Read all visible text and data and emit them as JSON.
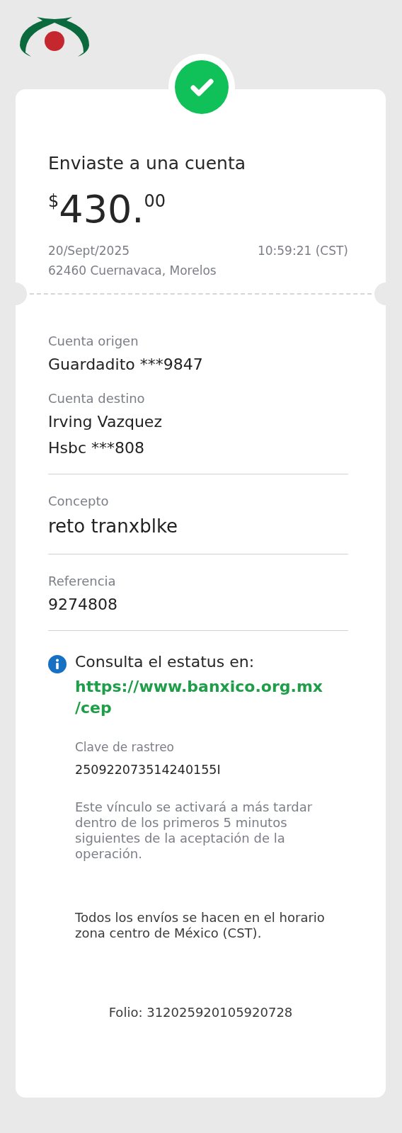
{
  "transfer": {
    "title": "Enviaste a una cuenta",
    "amount": {
      "currency": "$",
      "whole": "430.",
      "cents": "00"
    },
    "date": "20/Sept/2025",
    "time": "10:59:21 (CST)",
    "location": "62460 Cuernavaca, Morelos"
  },
  "fields": [
    {
      "label": "Cuenta origen",
      "lines": [
        "Guardadito ***9847"
      ],
      "kind": "plain"
    },
    {
      "label": "Cuenta destino",
      "lines": [
        "Irving Vazquez",
        "Hsbc ***808"
      ],
      "kind": "plain"
    },
    {
      "label": "Concepto",
      "lines": [
        "reto tranxblke"
      ],
      "kind": "large"
    },
    {
      "label": "Referencia",
      "lines": [
        "9274808"
      ],
      "kind": "plain"
    }
  ],
  "info": {
    "heading": "Consulta el estatus en:",
    "link": "https://www.banxico.org.mx /cep",
    "tracking_label": "Clave de rastreo",
    "tracking_key": "250922073514240155I",
    "note": "Este vínculo se activará a más tardar dentro de los primeros 5 minutos siguientes de la aceptación de la operación."
  },
  "timezone_note": "Todos los envíos se hacen en el horario zona centro de México (CST).",
  "folio": "Folio: 312025920105920728"
}
